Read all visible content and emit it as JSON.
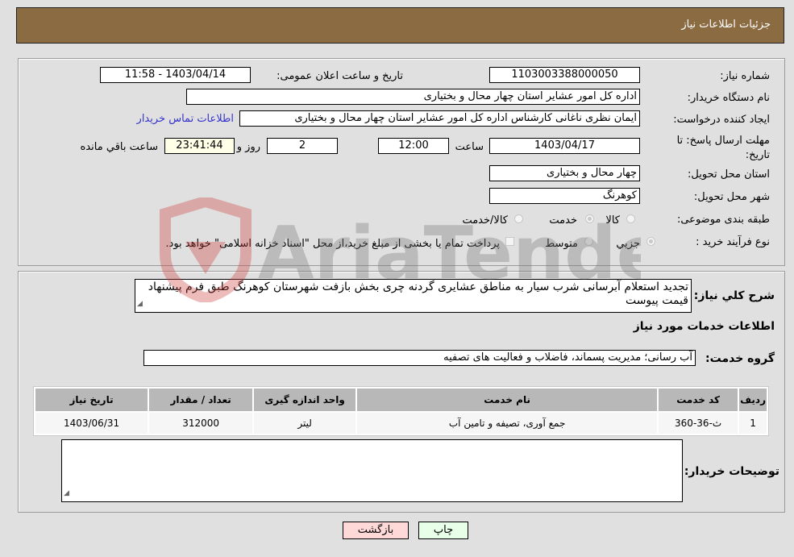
{
  "header": {
    "title": "جزئیات اطلاعات نیاز"
  },
  "form": {
    "need_number": {
      "label": "شماره نیاز:",
      "value": "1103003388000050"
    },
    "announce_datetime": {
      "label": "تاریخ و ساعت اعلان عمومی:",
      "value": "1403/04/14 - 11:58"
    },
    "buyer_org": {
      "label": "نام دستگاه خریدار:",
      "value": "اداره کل امور عشایر استان چهار محال و بختیاری"
    },
    "requester": {
      "label": "ایجاد کننده درخواست:",
      "value": "ایمان نظری ناغانی کارشناس اداره کل امور عشایر استان چهار محال و بختیاری",
      "contact_link": "اطلاعات تماس خریدار"
    },
    "deadline": {
      "label": "مهلت ارسال پاسخ: تا تاریخ:",
      "date": "1403/04/17",
      "time_label": "ساعت",
      "time": "12:00",
      "days": "2",
      "days_label": "روز و",
      "remaining": "23:41:44",
      "remaining_label": "ساعت باقي مانده"
    },
    "province": {
      "label": "استان محل تحویل:",
      "value": "چهار محال و بختیاری"
    },
    "city": {
      "label": "شهر محل تحویل:",
      "value": "کوهرنگ"
    },
    "category": {
      "label": "طبقه بندی موضوعی:",
      "options": [
        {
          "label": "کالا",
          "checked": false
        },
        {
          "label": "خدمت",
          "checked": true
        },
        {
          "label": "کالا/خدمت",
          "checked": false
        }
      ]
    },
    "process": {
      "label": "نوع فرآیند خرید :",
      "options": [
        {
          "label": "جزيي",
          "checked": true
        },
        {
          "label": "متوسط",
          "checked": false
        }
      ],
      "treasury_note": "پرداخت تمام یا بخشی از مبلغ خرید،از محل \"اسناد خزانه اسلامی\" خواهد بود."
    }
  },
  "details": {
    "description_label": "شرح كلي نياز:",
    "description": "تجدید استعلام آبرسانی شرب سیار به مناطق عشایری گردنه چری بخش بازفت شهرستان کوهرنگ طبق فرم پیشنهاد قیمت پیوست",
    "services_title": "اطلاعات خدمات مورد نیاز",
    "service_group_label": "گروه خدمت:",
    "service_group": "آب رسانی؛ مدیریت پسماند، فاضلاب و فعالیت های تصفیه",
    "table": {
      "headers": [
        "ردیف",
        "کد خدمت",
        "نام خدمت",
        "واحد اندازه گیری",
        "تعداد / مقدار",
        "تاریخ نیاز"
      ],
      "rows": [
        [
          "1",
          "ث-36-360",
          "جمع آوری، تصیفه و تامین آب",
          "لیتر",
          "312000",
          "1403/06/31"
        ]
      ]
    },
    "buyer_notes_label": "توضیحات خریدار:",
    "buyer_notes": ""
  },
  "buttons": {
    "back": "بازگشت",
    "print": "چاپ"
  },
  "watermark": {
    "text": "AriaTender.neT"
  }
}
